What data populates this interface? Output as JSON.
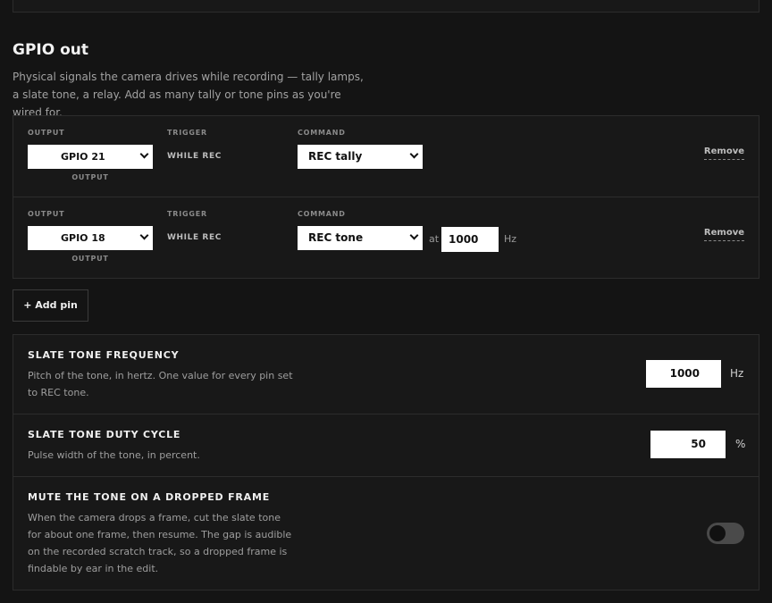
{
  "section": {
    "title": "GPIO out",
    "description": "Physical signals the camera drives while recording — tally lamps, a slate tone, a relay. Add as many tally or tone pins as you're wired for."
  },
  "pins": [
    {
      "output_caption": "OUTPUT",
      "trigger_caption": "TRIGGER",
      "command_caption": "COMMAND",
      "output_value": "GPIO 21",
      "output_sub": "OUTPUT",
      "trigger_value": "WHILE REC",
      "command_value": "REC tally",
      "remove_label": "Remove"
    },
    {
      "output_caption": "OUTPUT",
      "trigger_caption": "TRIGGER",
      "command_caption": "COMMAND",
      "output_value": "GPIO 18",
      "output_sub": "OUTPUT",
      "trigger_value": "WHILE REC",
      "command_value": "REC tone",
      "at_label": "at",
      "frequency_value": "1000",
      "frequency_unit": "Hz",
      "remove_label": "Remove"
    }
  ],
  "add_pin_label": "+ Add pin",
  "settings": {
    "frequency": {
      "title": "SLATE TONE FREQUENCY",
      "description": "Pitch of the tone, in hertz. One value for every pin set to REC tone.",
      "value": "1000",
      "unit": "Hz"
    },
    "duty": {
      "title": "SLATE TONE DUTY CYCLE",
      "description": "Pulse width of the tone, in percent.",
      "value": "50",
      "unit": "%"
    },
    "mute": {
      "title": "MUTE THE TONE ON A DROPPED FRAME",
      "description": "When the camera drops a frame, cut the slate tone for about one frame, then resume. The gap is audible on the recorded scratch track, so a dropped frame is findable by ear in the edit.",
      "enabled": false
    }
  },
  "colors": {
    "background": "#141414",
    "panel": "#181818",
    "border": "#2c2c2c",
    "input_bg": "#ffffff",
    "toggle_off": "#4a4a4a"
  }
}
